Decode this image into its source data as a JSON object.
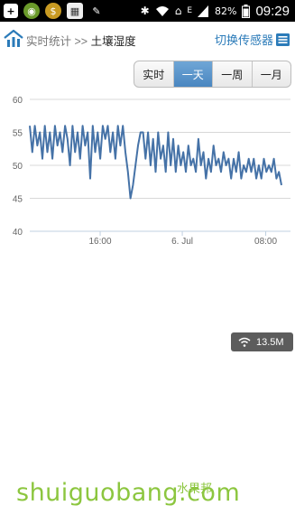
{
  "status_bar": {
    "battery": "82%",
    "time": "09:29",
    "icons": [
      "plus-icon",
      "app-icon",
      "app-icon",
      "calendar-icon",
      "broom-icon",
      "bluetooth-icon",
      "wifi-icon",
      "home-icon",
      "signal-icon",
      "battery-icon"
    ]
  },
  "header": {
    "breadcrumb_parent": "实时统计",
    "separator": ">>",
    "current": "土壤湿度",
    "switch_label": "切换传感器"
  },
  "range_tabs": {
    "items": [
      "实时",
      "一天",
      "一周",
      "一月"
    ],
    "active": "一天"
  },
  "chart_data": {
    "type": "line",
    "ylim": [
      40,
      60
    ],
    "y_ticks": [
      "60",
      "55",
      "50",
      "45",
      "40"
    ],
    "x_ticks": [
      "16:00",
      "6. Jul",
      "08:00"
    ],
    "series": [
      {
        "color": "#4572a7",
        "values": [
          56,
          52,
          56,
          53,
          55,
          51,
          56,
          52,
          55,
          51,
          56,
          53,
          55,
          52,
          56,
          54,
          50,
          56,
          52,
          55,
          51,
          56,
          53,
          55,
          48,
          56,
          52,
          55,
          51,
          56,
          54,
          56,
          52,
          55,
          51,
          56,
          53,
          56,
          52,
          49,
          45,
          47,
          50,
          53,
          55,
          55,
          51,
          55,
          50,
          54,
          49,
          55,
          51,
          53,
          49,
          55,
          50,
          54,
          49,
          53,
          50,
          52,
          49,
          53,
          50,
          51,
          49,
          54,
          50,
          52,
          48,
          51,
          49,
          53,
          50,
          51,
          49,
          52,
          50,
          51,
          48,
          51,
          49,
          52,
          48,
          50,
          49,
          51,
          49,
          51,
          48,
          50,
          48,
          51,
          49,
          50,
          49,
          51,
          48,
          49,
          47
        ]
      }
    ]
  },
  "network_badge": {
    "speed": "13.5M",
    "icon": "wifi-icon"
  },
  "watermark": {
    "text": "shuiguobang.com",
    "cn": "水果邦"
  }
}
